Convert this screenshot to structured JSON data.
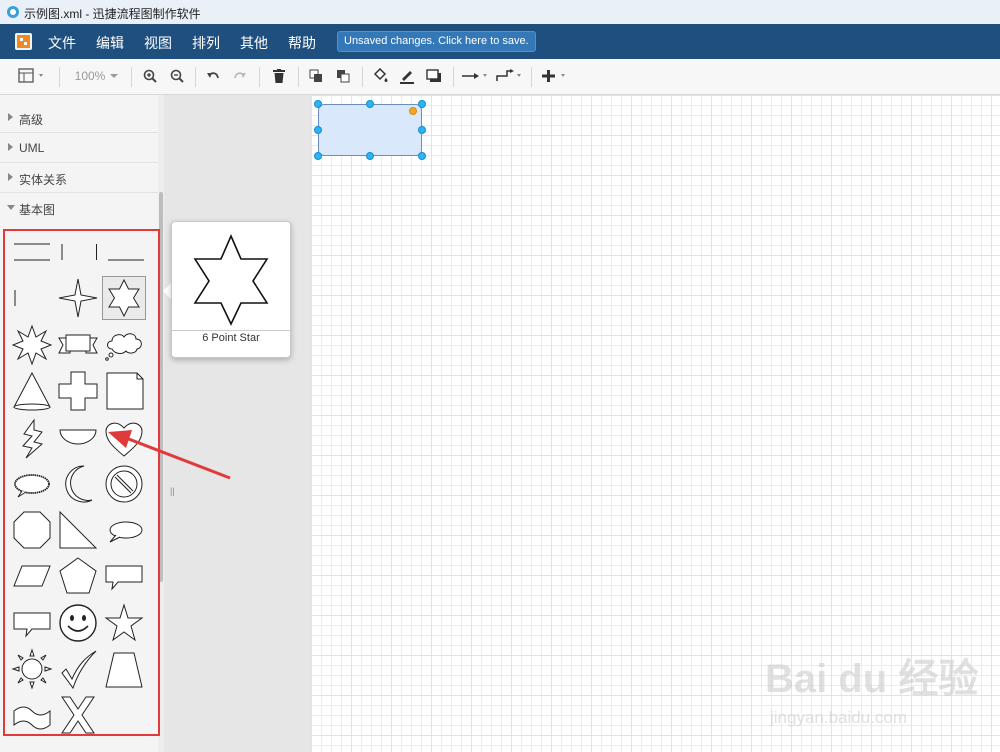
{
  "window": {
    "title": "示例图.xml - 迅捷流程图制作软件",
    "icon": "app-icon"
  },
  "menu": {
    "items": [
      "文件",
      "编辑",
      "视图",
      "排列",
      "其他",
      "帮助"
    ],
    "unsaved_notice": "Unsaved changes. Click here to save."
  },
  "toolbar": {
    "zoom": "100%",
    "icons": [
      "format-panel-icon",
      "zoom-in-icon",
      "zoom-out-icon",
      "undo-icon",
      "redo-icon",
      "delete-icon",
      "to-front-icon",
      "to-back-icon",
      "fill-color-icon",
      "line-color-icon",
      "shadow-icon",
      "connection-icon",
      "waypoints-icon",
      "insert-icon"
    ]
  },
  "sidebar": {
    "sections": [
      {
        "label": "高级",
        "expanded": false
      },
      {
        "label": "UML",
        "expanded": false
      },
      {
        "label": "实体关系",
        "expanded": false
      },
      {
        "label": "基本图",
        "expanded": true
      }
    ],
    "shapes": [
      "horizontal-line",
      "vertical-line",
      "partial-rectangle",
      "vertical-line-small",
      "4-point-star",
      "6-point-star",
      "8-point-star",
      "banner",
      "cloud-callout",
      "cone",
      "cross",
      "folded-corner",
      "flash",
      "half-circle",
      "heart",
      "cloud-speech",
      "moon",
      "no-symbol",
      "octagon",
      "right-triangle",
      "oval-callout",
      "parallelogram",
      "pentagon",
      "rectangular-callout",
      "rectangular-callout-2",
      "smiley",
      "star",
      "sun",
      "tick",
      "trapezoid",
      "wave",
      "x-shape"
    ]
  },
  "preview": {
    "label": "6 Point Star"
  },
  "watermark": {
    "brand": "Bai du 经验",
    "url": "jingyan.baidu.com"
  },
  "colors": {
    "menubar": "#1f4f7f",
    "selection_fill": "#dae8fc",
    "handle": "#29b6f2",
    "highlight": "#e03a3a"
  }
}
